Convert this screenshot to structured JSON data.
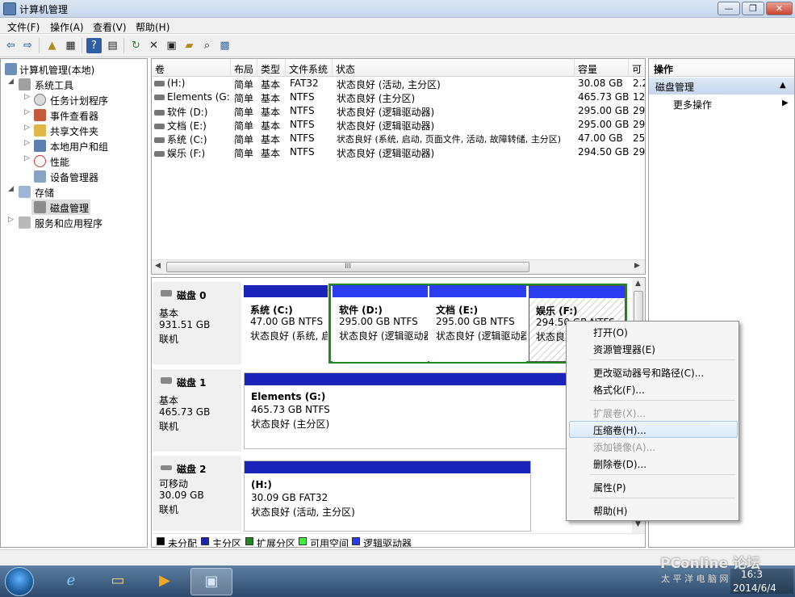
{
  "window": {
    "title": "计算机管理",
    "buttons": {
      "minimize": "—",
      "maximize": "❐",
      "close": "✕"
    }
  },
  "menu": [
    "文件(F)",
    "操作(A)",
    "查看(V)",
    "帮助(H)"
  ],
  "toolbar_icons": [
    "back-icon",
    "forward-icon",
    "up-icon",
    "console-tree-icon",
    "help-icon",
    "view-icon",
    "refresh-icon",
    "delete-icon",
    "properties-icon",
    "open-icon",
    "search-icon",
    "disk-icon"
  ],
  "tree": {
    "root": "计算机管理(本地)",
    "system_tools": "系统工具",
    "task_scheduler": "任务计划程序",
    "event_viewer": "事件查看器",
    "shared_folders": "共享文件夹",
    "local_users": "本地用户和组",
    "performance": "性能",
    "device_manager": "设备管理器",
    "storage": "存储",
    "disk_management": "磁盘管理",
    "services": "服务和应用程序"
  },
  "volume_table": {
    "headers": [
      "卷",
      "布局",
      "类型",
      "文件系统",
      "状态",
      "容量",
      "可"
    ],
    "rows": [
      {
        "vol": "(H:)",
        "layout": "简单",
        "type": "基本",
        "fs": "FAT32",
        "status": "状态良好 (活动, 主分区)",
        "cap": "30.08 GB",
        "free": "2.2"
      },
      {
        "vol": "Elements (G:)",
        "layout": "简单",
        "type": "基本",
        "fs": "NTFS",
        "status": "状态良好 (主分区)",
        "cap": "465.73 GB",
        "free": "12"
      },
      {
        "vol": "软件 (D:)",
        "layout": "简单",
        "type": "基本",
        "fs": "NTFS",
        "status": "状态良好 (逻辑驱动器)",
        "cap": "295.00 GB",
        "free": "29"
      },
      {
        "vol": "文档 (E:)",
        "layout": "简单",
        "type": "基本",
        "fs": "NTFS",
        "status": "状态良好 (逻辑驱动器)",
        "cap": "295.00 GB",
        "free": "29"
      },
      {
        "vol": "系统 (C:)",
        "layout": "简单",
        "type": "基本",
        "fs": "NTFS",
        "status": "状态良好 (系统, 启动, 页面文件, 活动, 故障转储, 主分区)",
        "cap": "47.00 GB",
        "free": "25"
      },
      {
        "vol": "娱乐 (F:)",
        "layout": "简单",
        "type": "基本",
        "fs": "NTFS",
        "status": "状态良好 (逻辑驱动器)",
        "cap": "294.50 GB",
        "free": "29"
      }
    ],
    "hscroll_label": "III"
  },
  "disks": [
    {
      "name": "磁盘 0",
      "type": "基本",
      "size": "931.51 GB",
      "state": "联机",
      "parts": [
        {
          "name": "系统 (C:)",
          "size": "47.00 GB NTFS",
          "status": "状态良好 (系统, 启"
        },
        {
          "name": "软件 (D:)",
          "size": "295.00 GB NTFS",
          "status": "状态良好 (逻辑驱动器"
        },
        {
          "name": "文档 (E:)",
          "size": "295.00 GB NTFS",
          "status": "状态良好 (逻辑驱动器"
        },
        {
          "name": "娱乐 (F:)",
          "size": "294.50 GB NTFS",
          "status": "状态良好"
        }
      ]
    },
    {
      "name": "磁盘 1",
      "type": "基本",
      "size": "465.73 GB",
      "state": "联机",
      "parts": [
        {
          "name": "Elements (G:)",
          "size": "465.73 GB NTFS",
          "status": "状态良好 (主分区)"
        }
      ]
    },
    {
      "name": "磁盘 2",
      "type": "可移动",
      "size": "30.09 GB",
      "state": "联机",
      "parts": [
        {
          "name": "(H:)",
          "size": "30.09 GB FAT32",
          "status": "状态良好 (活动, 主分区)"
        }
      ]
    }
  ],
  "legend": [
    {
      "label": "未分配",
      "color": "#000000"
    },
    {
      "label": "主分区",
      "color": "#1b24b8"
    },
    {
      "label": "扩展分区",
      "color": "#1f8a1f"
    },
    {
      "label": "可用空间",
      "color": "#3df03d"
    },
    {
      "label": "逻辑驱动器",
      "color": "#2a3cf0"
    }
  ],
  "actions": {
    "title": "操作",
    "section": "磁盘管理",
    "more": "更多操作"
  },
  "context_menu": {
    "open": "打开(O)",
    "explorer": "资源管理器(E)",
    "change_letter": "更改驱动器号和路径(C)...",
    "format": "格式化(F)...",
    "extend": "扩展卷(X)...",
    "shrink": "压缩卷(H)...",
    "mirror": "添加镜像(A)...",
    "delete": "删除卷(D)...",
    "properties": "属性(P)",
    "help": "帮助(H)"
  },
  "taskbar": {
    "clock_time": "16:3",
    "clock_date": "2014/6/4",
    "watermark": "PConline 论坛",
    "watermark_sub": "太 平 洋 电 脑 网"
  },
  "colors": {
    "primary": "#1b24b8",
    "logical": "#2a3cf0",
    "extended": "#1f8a1f"
  }
}
